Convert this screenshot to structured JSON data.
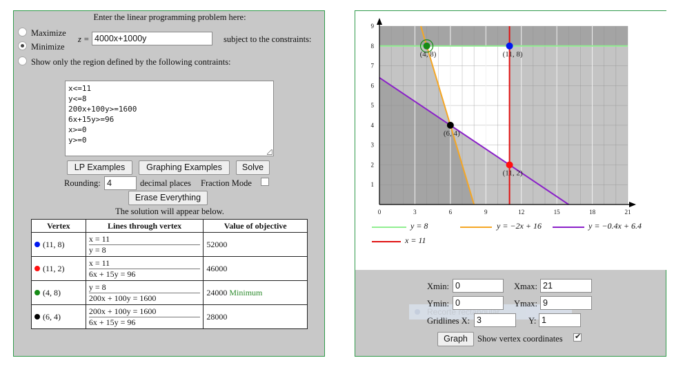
{
  "lp": {
    "heading": "Enter the linear programming problem here:",
    "maximize_label": "Maximize",
    "minimize_label": "Minimize",
    "selected_mode": "Minimize",
    "z_label": "z =",
    "objective_value": "4000x+1000y",
    "subject_to": "subject to the constraints:",
    "region_only_label": "Show only the region defined by the following contraints:",
    "constraints_text": "x<=11\ny<=8\n200x+100y>=1600\n6x+15y>=96\nx>=0\ny>=0",
    "buttons": {
      "lp_examples": "LP Examples",
      "graphing_examples": "Graphing Examples",
      "solve": "Solve",
      "erase": "Erase Everything"
    },
    "rounding_label": "Rounding:",
    "rounding_value": "4",
    "decimal_places": "decimal places",
    "fraction_mode": "Fraction Mode",
    "solution_note": "The solution will appear below."
  },
  "table": {
    "headers": [
      "Vertex",
      "Lines through vertex",
      "Value of objective"
    ],
    "rows": [
      {
        "color": "#0018f0",
        "vertex": "(11, 8)",
        "line1": "x = 11",
        "line2": "y = 8",
        "value": "52000",
        "note": ""
      },
      {
        "color": "#ff1010",
        "vertex": "(11, 2)",
        "line1": "x = 11",
        "line2": "6x + 15y = 96",
        "value": "46000",
        "note": ""
      },
      {
        "color": "#168a16",
        "vertex": "(4, 8)",
        "line1": "y = 8",
        "line2": "200x + 100y = 1600",
        "value": "24000",
        "note": "Minimum"
      },
      {
        "color": "#000000",
        "vertex": "(6, 4)",
        "line1": "200x + 100y = 1600",
        "line2": "6x + 15y = 96",
        "value": "28000",
        "note": ""
      }
    ]
  },
  "chart_data": {
    "type": "line",
    "xlim": [
      0,
      21
    ],
    "ylim": [
      0,
      9
    ],
    "x_ticks": [
      "0",
      "3",
      "6",
      "9",
      "12",
      "15",
      "18",
      "21"
    ],
    "y_ticks": [
      "1",
      "2",
      "3",
      "4",
      "5",
      "6",
      "7",
      "8",
      "9"
    ],
    "grid": true,
    "series": [
      {
        "name": "y = 8",
        "color": "#90ee90",
        "points": [
          [
            0,
            8
          ],
          [
            21,
            8
          ]
        ]
      },
      {
        "name": "y = −2x + 16",
        "color": "#f5a623",
        "points": [
          [
            3.5,
            9
          ],
          [
            8,
            0
          ]
        ]
      },
      {
        "name": "y = −0.4x + 6.4",
        "color": "#8a1fc8",
        "points": [
          [
            0,
            6.4
          ],
          [
            16,
            0
          ]
        ]
      },
      {
        "name": "x = 11",
        "color": "#e01010",
        "points": [
          [
            11,
            0
          ],
          [
            11,
            9
          ]
        ]
      }
    ],
    "vertices": [
      {
        "x": 11,
        "y": 8,
        "label": "(11, 8)",
        "color": "#0018f0"
      },
      {
        "x": 11,
        "y": 2,
        "label": "(11, 2)",
        "color": "#ff1010"
      },
      {
        "x": 4,
        "y": 8,
        "label": "(4, 8)",
        "color": "#168a16",
        "highlight": true
      },
      {
        "x": 6,
        "y": 4,
        "label": "(6, 4)",
        "color": "#000000"
      }
    ]
  },
  "settings": {
    "xmin_label": "Xmin:",
    "xmin": "0",
    "xmax_label": "Xmax:",
    "xmax": "21",
    "ymin_label": "Ymin:",
    "ymin": "0",
    "ymax_label": "Ymax:",
    "ymax": "9",
    "gridx_label": "Gridlines X:",
    "gridx": "3",
    "gridy_label": "Y:",
    "gridy": "1",
    "graph_button": "Graph",
    "show_vertex_label": "Show vertex coordinates",
    "ghost_text": "Recorte rectangular"
  }
}
